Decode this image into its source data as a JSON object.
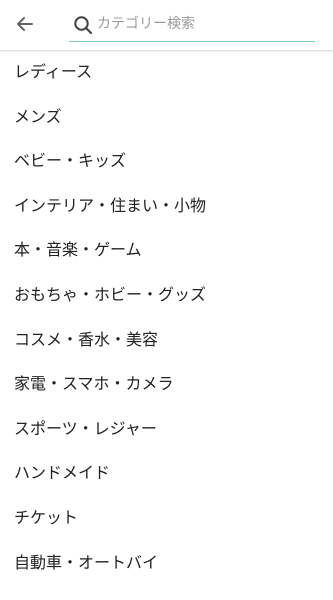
{
  "header": {
    "back_icon": "arrow-left-icon",
    "search_icon": "search-icon",
    "search_placeholder": "カテゴリー検索",
    "search_value": "",
    "accent_color": "#78c7b4"
  },
  "categories": [
    {
      "label": "レディース"
    },
    {
      "label": "メンズ"
    },
    {
      "label": "ベビー・キッズ"
    },
    {
      "label": "インテリア・住まい・小物"
    },
    {
      "label": "本・音楽・ゲーム"
    },
    {
      "label": "おもちゃ・ホビー・グッズ"
    },
    {
      "label": "コスメ・香水・美容"
    },
    {
      "label": "家電・スマホ・カメラ"
    },
    {
      "label": "スポーツ・レジャー"
    },
    {
      "label": "ハンドメイド"
    },
    {
      "label": "チケット"
    },
    {
      "label": "自動車・オートバイ"
    }
  ]
}
